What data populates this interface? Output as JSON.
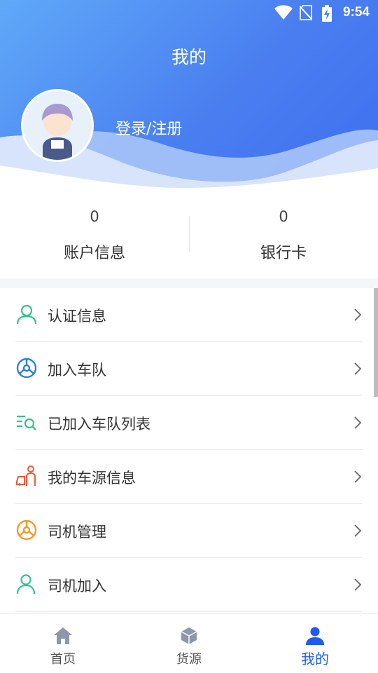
{
  "status_bar": {
    "time": "9:54",
    "icons": [
      "wifi-icon",
      "no-sim-icon",
      "battery-charging-icon"
    ]
  },
  "header": {
    "title": "我的",
    "login_label": "登录/注册"
  },
  "stats": [
    {
      "value": "0",
      "label": "账户信息"
    },
    {
      "value": "0",
      "label": "银行卡"
    }
  ],
  "menu": [
    {
      "label": "认证信息",
      "icon": "user-verify-icon",
      "color": "#2fc58a"
    },
    {
      "label": "加入车队",
      "icon": "steering-wheel-icon",
      "color": "#2f7fe0"
    },
    {
      "label": "已加入车队列表",
      "icon": "list-search-icon",
      "color": "#2fc58a"
    },
    {
      "label": "我的车源信息",
      "icon": "driver-car-icon",
      "color": "#ee5a3c"
    },
    {
      "label": "司机管理",
      "icon": "steering-wheel-icon",
      "color": "#f49a2a"
    },
    {
      "label": "司机加入",
      "icon": "user-add-icon",
      "color": "#2fc58a"
    }
  ],
  "tabs": [
    {
      "label": "首页",
      "icon": "home-icon",
      "active": false
    },
    {
      "label": "货源",
      "icon": "package-icon",
      "active": false
    },
    {
      "label": "我的",
      "icon": "profile-icon",
      "active": true
    }
  ],
  "colors": {
    "accent": "#1e5cf0",
    "header_start": "#5fa9f8",
    "header_end": "#3f6ef0"
  }
}
